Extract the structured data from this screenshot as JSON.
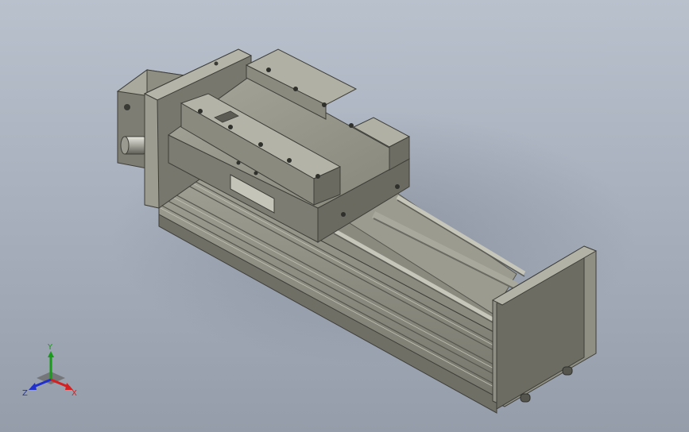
{
  "viewport": {
    "background_top": "#b9c1cd",
    "background_bottom": "#959daa"
  },
  "model": {
    "part_color": "#8c8c80",
    "part_shadow": "#5f5f57",
    "part_highlight": "#b5b5a8"
  },
  "triad": {
    "x_label": "X",
    "y_label": "Y",
    "z_label": "Z",
    "x_color": "#d42020",
    "y_color": "#1a9a1a",
    "z_color": "#2030c8"
  }
}
